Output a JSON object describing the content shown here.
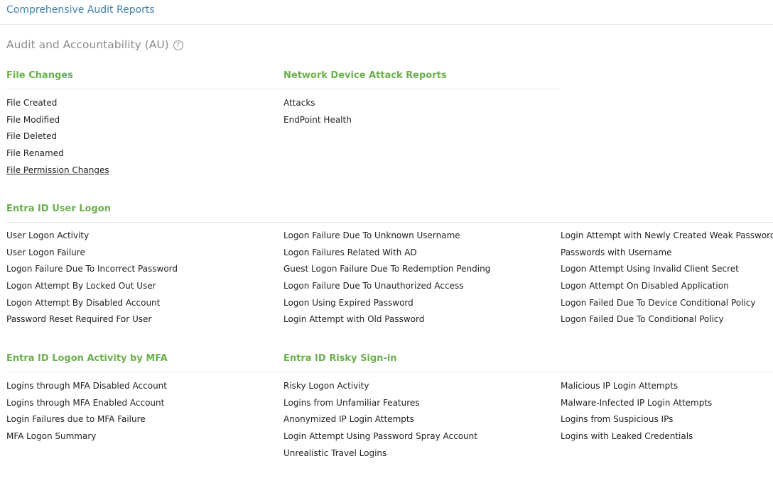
{
  "top_title": "Comprehensive Audit Reports",
  "section": {
    "title": "Audit and Accountability (AU)",
    "help_icon": "?"
  },
  "groups": {
    "file_changes": {
      "title": "File Changes",
      "items": [
        "File Created",
        "File Modified",
        "File Deleted",
        "File Renamed",
        "File Permission Changes"
      ]
    },
    "network_attacks": {
      "title": "Network Device Attack Reports",
      "items": [
        "Attacks",
        "EndPoint Health"
      ]
    },
    "entra_logon": {
      "title": "Entra ID User Logon",
      "col1": [
        "User Logon Activity",
        "User Logon Failure",
        "Logon Failure Due To Incorrect Password",
        "Logon Attempt By Locked Out User",
        "Logon Attempt By Disabled Account",
        "Password Reset Required For User"
      ],
      "col2": [
        "Logon Failure Due To Unknown Username",
        "Logon Failures Related With AD",
        "Guest Logon Failure Due To Redemption Pending",
        "Logon Failure Due To Unauthorized Access",
        "Logon Using Expired Password",
        "Login Attempt with Old Password"
      ],
      "col3": [
        "Login Attempt with Newly Created Weak Password",
        "Passwords with Username",
        "Logon Attempt Using Invalid Client Secret",
        "Logon Attempt On Disabled Application",
        "Logon Failed Due To Device Conditional Policy",
        "Logon Failed Due To Conditional Policy"
      ]
    },
    "entra_mfa": {
      "title": "Entra ID Logon Activity by MFA",
      "items": [
        "Logins through MFA Disabled Account",
        "Logins through MFA Enabled Account",
        "Login Failures due to MFA Failure",
        "MFA Logon Summary"
      ]
    },
    "entra_risky": {
      "title": "Entra ID Risky Sign-in",
      "col1": [
        "Risky Logon Activity",
        "Logins from Unfamiliar Features",
        "Anonymized IP Login Attempts",
        "Login Attempt Using Password Spray Account",
        "Unrealistic Travel Logins"
      ],
      "col2": [
        "Malicious IP Login Attempts",
        "Malware-Infected IP Login Attempts",
        "Logins from Suspicious IPs",
        "Logins with Leaked Credentials"
      ]
    }
  }
}
